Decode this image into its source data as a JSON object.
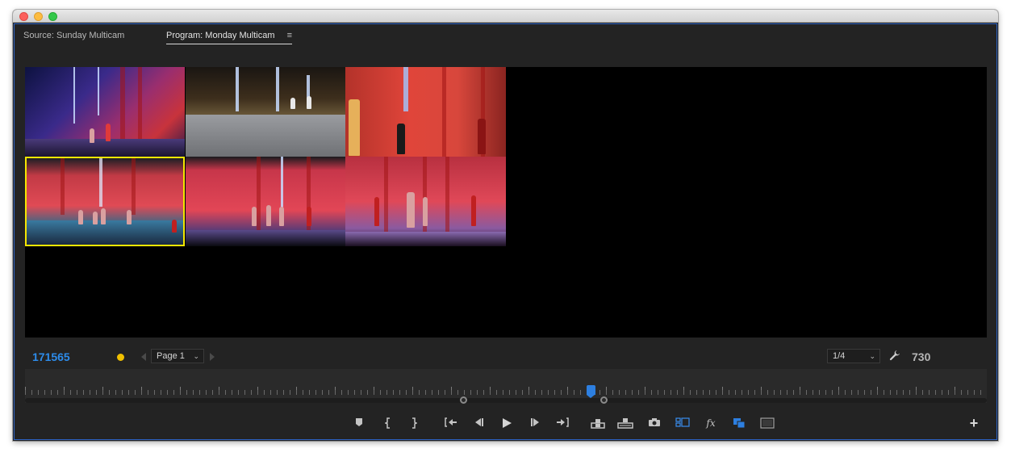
{
  "tabs": {
    "source_label": "Source: Sunday Multicam",
    "program_label": "Program: Monday Multicam",
    "program_menu_icon": "hamburger-icon"
  },
  "status": {
    "timecode": "171565",
    "page_select": "Page 1",
    "zoom_select": "1/4",
    "frame_count": "730",
    "timecode_color": "#2d8ceb",
    "indicator_color": "#f0c000",
    "active_camera_border": "#f5e600"
  },
  "viewer": {
    "camera_angles": 6,
    "active_camera": 4
  },
  "timeline": {
    "playhead_color": "#2d7fe0"
  },
  "transport": {
    "buttons": [
      {
        "name": "add-marker-button",
        "icon": "marker-icon"
      },
      {
        "name": "mark-in-button",
        "icon": "mark-in-icon"
      },
      {
        "name": "mark-out-button",
        "icon": "mark-out-icon"
      },
      {
        "name": "go-to-in-button",
        "icon": "go-to-in-icon"
      },
      {
        "name": "step-back-button",
        "icon": "step-back-icon"
      },
      {
        "name": "play-button",
        "icon": "play-icon"
      },
      {
        "name": "step-forward-button",
        "icon": "step-forward-icon"
      },
      {
        "name": "go-to-out-button",
        "icon": "go-to-out-icon"
      },
      {
        "name": "lift-button",
        "icon": "lift-icon"
      },
      {
        "name": "extract-button",
        "icon": "extract-icon"
      },
      {
        "name": "export-frame-button",
        "icon": "camera-icon"
      },
      {
        "name": "multicam-view-button",
        "icon": "multicam-icon"
      },
      {
        "name": "effects-button",
        "icon": "fx-icon",
        "label": "fx"
      },
      {
        "name": "comparison-view-button",
        "icon": "comparison-icon"
      },
      {
        "name": "safe-margins-button",
        "icon": "safe-margins-icon"
      }
    ],
    "add_button_label": "+"
  }
}
